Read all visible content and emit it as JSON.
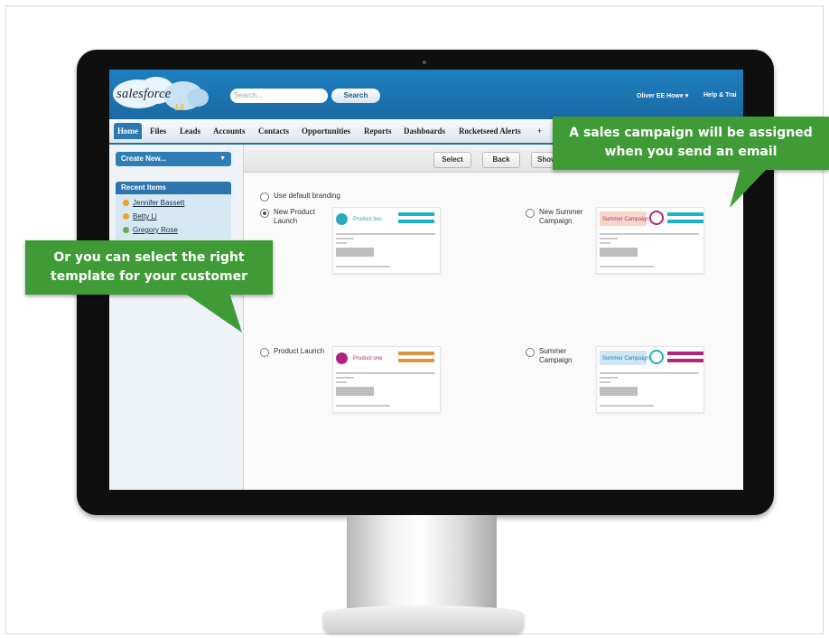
{
  "app": {
    "logo_text": "salesforce",
    "logo_version": "14"
  },
  "header": {
    "search_placeholder": "Search...",
    "search_button": "Search",
    "user_menu": "Oliver EE Howe",
    "help_link": "Help & Trai"
  },
  "tabs": [
    {
      "label": "Home",
      "active": true
    },
    {
      "label": "Files"
    },
    {
      "label": "Leads"
    },
    {
      "label": "Accounts"
    },
    {
      "label": "Contacts"
    },
    {
      "label": "Opportunities"
    },
    {
      "label": "Reports"
    },
    {
      "label": "Dashboards"
    },
    {
      "label": "Rocketseed Alerts"
    },
    {
      "label": "+"
    }
  ],
  "sidebar": {
    "create_new": "Create New...",
    "recent_title": "Recent Items",
    "recent_items": [
      "Jennifer Bassett",
      "Betty Li",
      "Gregory Rose"
    ]
  },
  "toolbar": {
    "select": "Select",
    "back": "Back",
    "show": "Show"
  },
  "options": {
    "default_branding": "Use default branding",
    "new_product_launch_1": "New Product",
    "new_product_launch_2": "Launch",
    "new_summer_campaign_1": "New Summer",
    "new_summer_campaign_2": "Campaign",
    "product_launch": "Product Launch",
    "summer_campaign_1": "Summer",
    "summer_campaign_2": "Campaign",
    "selected": "New Product Launch"
  },
  "thumbnails": {
    "product_two": "Product two",
    "product_one": "Product one",
    "summer_campaign": "Summer Campaign",
    "accent_teal": "#22b0c4",
    "accent_orange": "#e4943c",
    "accent_magenta": "#b3257d"
  },
  "callouts": {
    "right_line1": "A sales campaign will be assigned",
    "right_line2": "when you send an email",
    "left_line1": "Or you can select the right",
    "left_line2": "template for your customer",
    "color": "#3f9b36"
  }
}
